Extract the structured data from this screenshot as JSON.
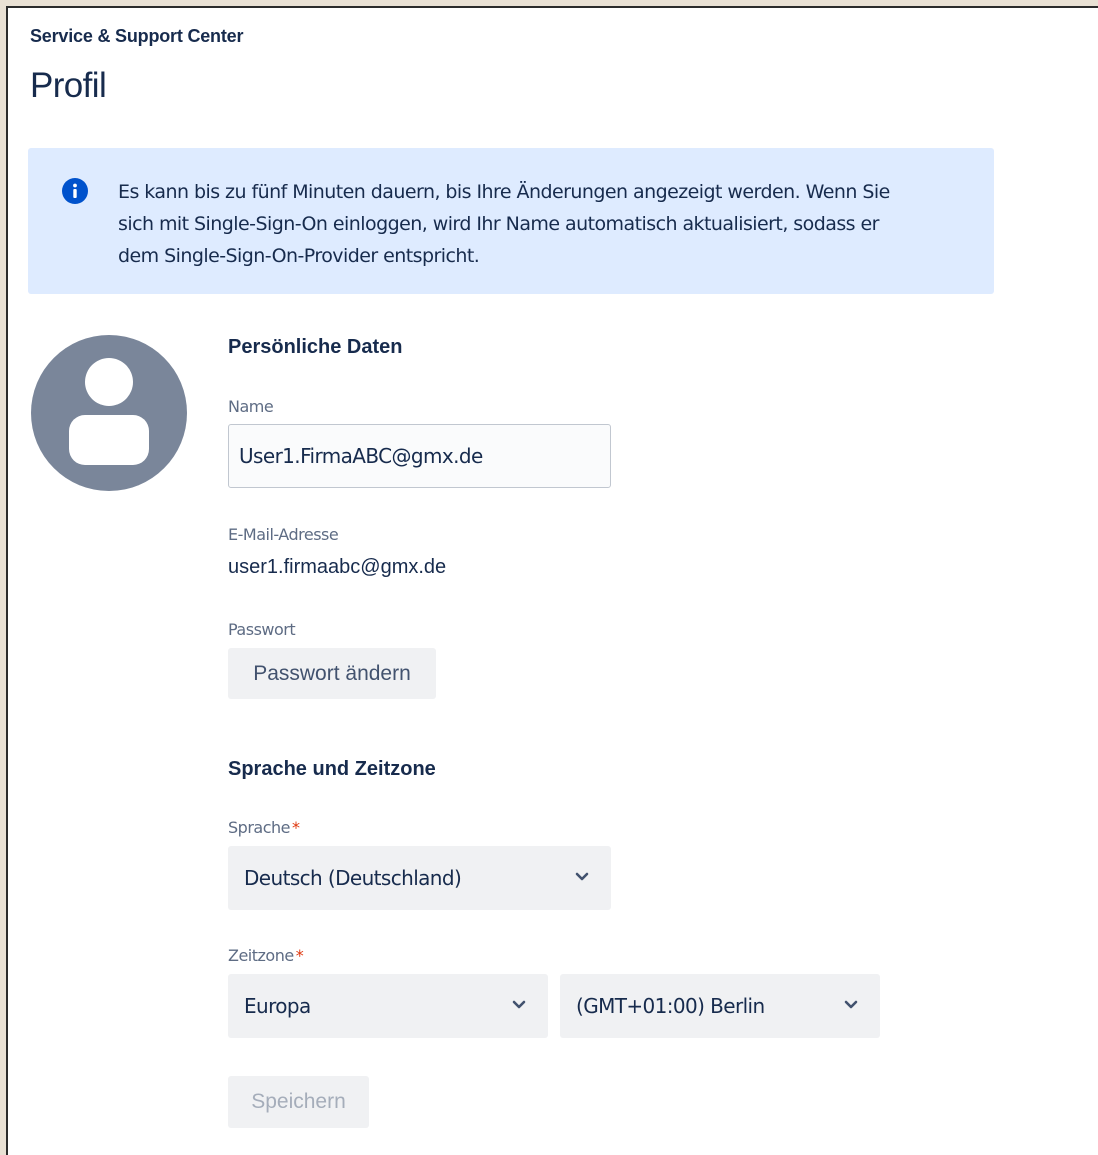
{
  "header": {
    "service_title": "Service & Support Center",
    "page_title": "Profil"
  },
  "info_banner": {
    "icon": "info-icon",
    "line1": "Es kann bis zu fünf Minuten dauern, bis Ihre Änderungen angezeigt werden. Wenn Sie",
    "line2": "sich mit Single-Sign-On einloggen, wird Ihr Name automatisch aktualisiert, sodass er",
    "line3": "dem Single-Sign-On-Provider entspricht.",
    "background_color": "#deebff",
    "icon_color": "#0052cc"
  },
  "avatar": {
    "icon": "user-avatar-icon",
    "color": "#7a869a"
  },
  "personal": {
    "heading": "Persönliche Daten",
    "name_label": "Name",
    "name_value": "User1.FirmaABC@gmx.de",
    "email_label": "E-Mail-Adresse",
    "email_value": "user1.firmaabc@gmx.de",
    "password_label": "Passwort",
    "password_button": "Passwort ändern"
  },
  "locale": {
    "heading": "Sprache und Zeitzone",
    "language_label": "Sprache",
    "required_marker": "*",
    "language_value": "Deutsch (Deutschland)",
    "timezone_label": "Zeitzone",
    "region_value": "Europa",
    "timezone_value": "(GMT+01:00) Berlin"
  },
  "actions": {
    "save_button": "Speichern",
    "save_enabled": false
  }
}
